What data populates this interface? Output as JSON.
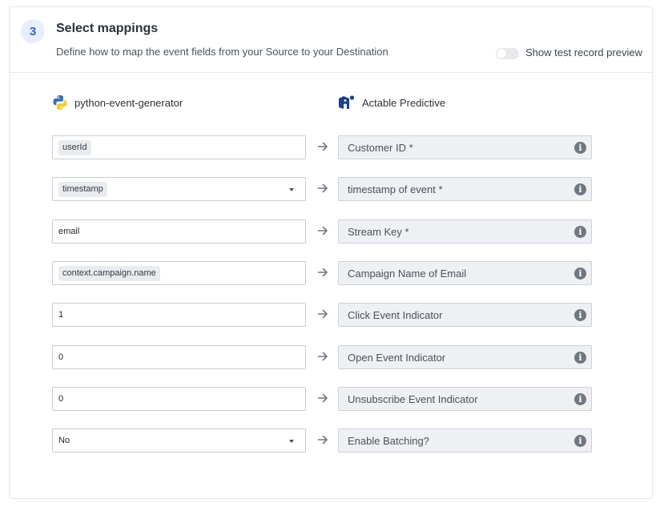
{
  "step": {
    "number": "3",
    "title": "Select mappings",
    "subtitle": "Define how to map the event fields from your Source to your Destination"
  },
  "preview_toggle": {
    "label": "Show test record preview",
    "on": false
  },
  "source": {
    "name": "python-event-generator",
    "icon": "python-icon"
  },
  "destination": {
    "name": "Actable Predictive",
    "icon": "actable-logo-icon"
  },
  "mappings": [
    {
      "source_value": "userId",
      "source_kind": "chip",
      "dropdown": false,
      "destination_label": "Customer ID *"
    },
    {
      "source_value": "timestamp",
      "source_kind": "chip",
      "dropdown": true,
      "destination_label": "timestamp of event *"
    },
    {
      "source_value": "email",
      "source_kind": "text",
      "dropdown": false,
      "destination_label": "Stream Key *"
    },
    {
      "source_value": "context.campaign.name",
      "source_kind": "chip",
      "dropdown": false,
      "destination_label": "Campaign Name of Email"
    },
    {
      "source_value": "1",
      "source_kind": "text",
      "dropdown": false,
      "destination_label": "Click Event Indicator"
    },
    {
      "source_value": "0",
      "source_kind": "text",
      "dropdown": false,
      "destination_label": "Open Event Indicator"
    },
    {
      "source_value": "0",
      "source_kind": "text",
      "dropdown": false,
      "destination_label": "Unsubscribe Event Indicator"
    },
    {
      "source_value": "No",
      "source_kind": "text",
      "dropdown": true,
      "destination_label": "Enable Batching?"
    }
  ],
  "colors": {
    "accent": "#2d63d6",
    "badge_bg": "#e8eefc",
    "info_icon": "#6f7782",
    "dest_field_bg": "#eef0f3"
  }
}
